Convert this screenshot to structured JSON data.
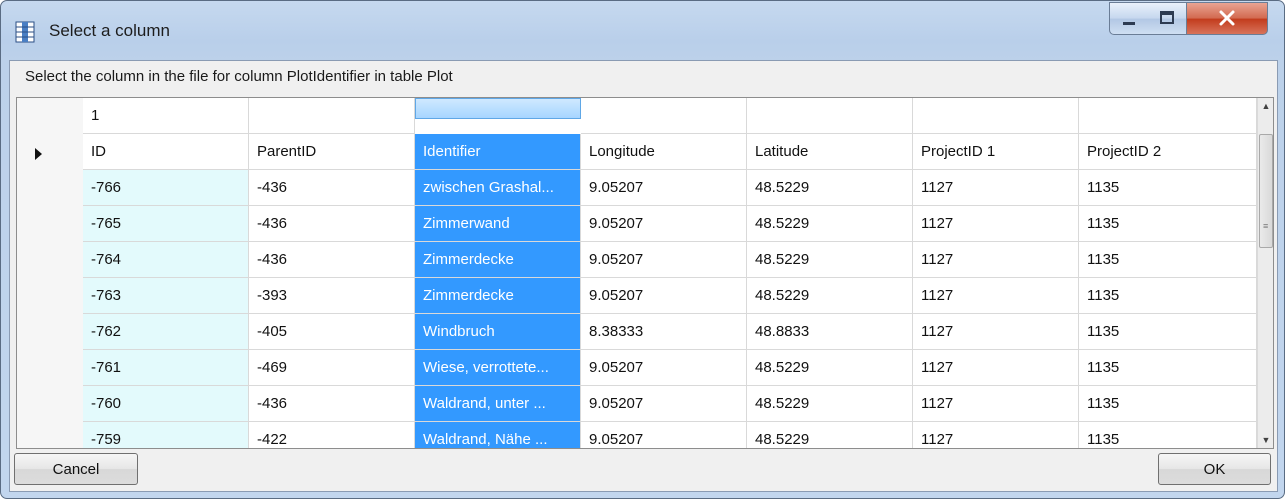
{
  "window": {
    "title": "Select a column",
    "icon": "table-columns-icon",
    "controls": [
      "minimize-icon",
      "maximize-icon",
      "close-icon"
    ]
  },
  "prompt_text": "Select the column in the file for column PlotIdentifier in table Plot",
  "grid": {
    "top_row": [
      "1",
      "",
      "",
      "",
      "",
      "",
      ""
    ],
    "headers": [
      "ID",
      "ParentID",
      "Identifier",
      "Longitude",
      "Latitude",
      "ProjectID 1",
      "ProjectID 2"
    ],
    "selected_column_index": 2,
    "rows": [
      [
        "-766",
        "-436",
        "zwischen Grashal...",
        "9.05207",
        "48.5229",
        "1127",
        "1135"
      ],
      [
        "-765",
        "-436",
        "Zimmerwand",
        "9.05207",
        "48.5229",
        "1127",
        "1135"
      ],
      [
        "-764",
        "-436",
        "Zimmerdecke",
        "9.05207",
        "48.5229",
        "1127",
        "1135"
      ],
      [
        "-763",
        "-393",
        "Zimmerdecke",
        "9.05207",
        "48.5229",
        "1127",
        "1135"
      ],
      [
        "-762",
        "-405",
        "Windbruch",
        "8.38333",
        "48.8833",
        "1127",
        "1135"
      ],
      [
        "-761",
        "-469",
        "Wiese, verrottete...",
        "9.05207",
        "48.5229",
        "1127",
        "1135"
      ],
      [
        "-760",
        "-436",
        "Waldrand, unter ...",
        "9.05207",
        "48.5229",
        "1127",
        "1135"
      ],
      [
        "-759",
        "-422",
        "Waldrand, Nähe ...",
        "9.05207",
        "48.5229",
        "1127",
        "1135"
      ]
    ]
  },
  "buttons": {
    "cancel": "Cancel",
    "ok": "OK"
  },
  "colors": {
    "selection": "#3399ff",
    "id_column": "#e3fafc"
  }
}
